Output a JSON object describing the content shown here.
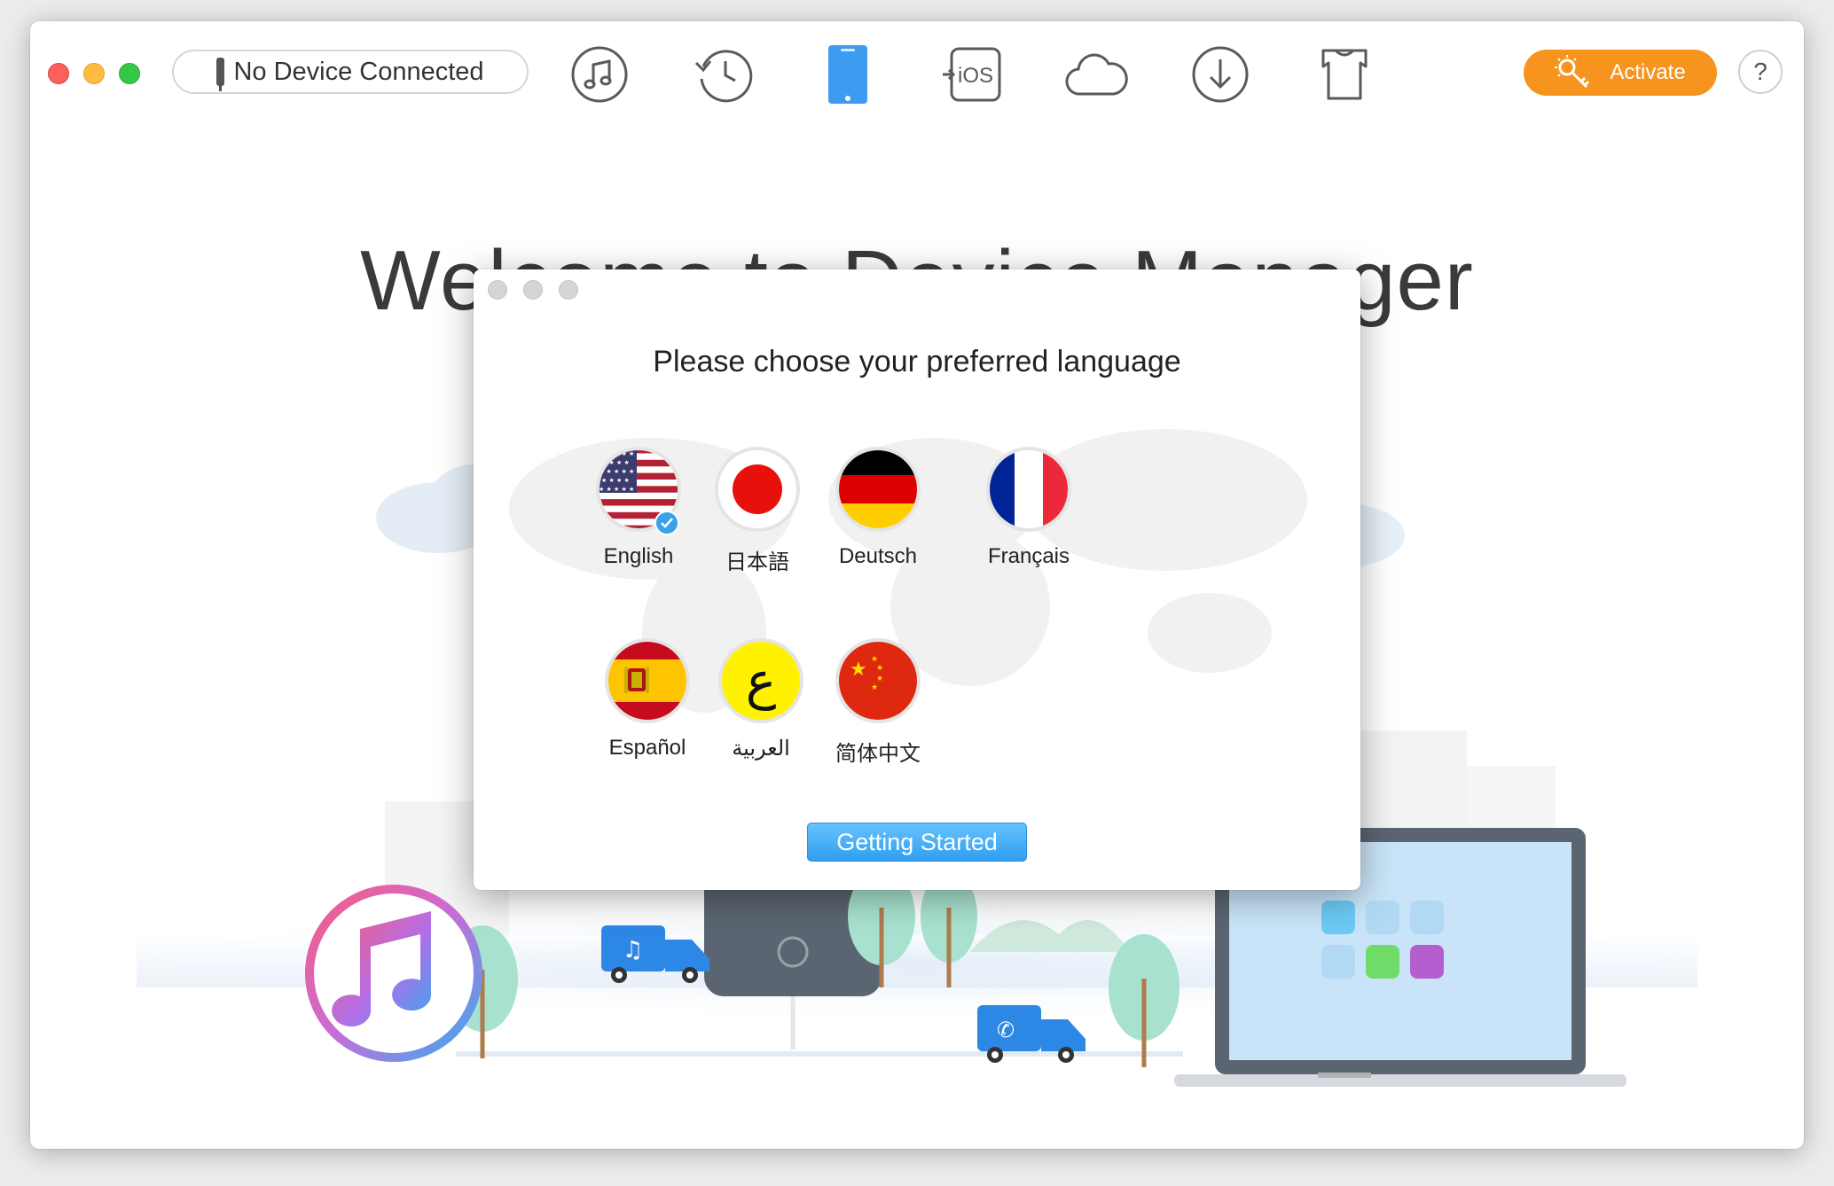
{
  "titlebar": {
    "device_status": "No Device Connected",
    "activate_label": "Activate",
    "help_label": "?",
    "toolbar_icons": [
      "music-icon",
      "history-icon",
      "device-icon",
      "ios-transfer-icon",
      "cloud-icon",
      "download-icon",
      "skin-icon"
    ],
    "ios_icon_text": "iOS"
  },
  "main": {
    "welcome_title": "Welcome to Device Manager"
  },
  "dialog": {
    "title": "Please choose your preferred language",
    "languages": [
      {
        "label": "English",
        "selected": true
      },
      {
        "label": "日本語",
        "selected": false
      },
      {
        "label": "Deutsch",
        "selected": false
      },
      {
        "label": "Français",
        "selected": false
      },
      {
        "label": "Español",
        "selected": false
      },
      {
        "label": "العربية",
        "selected": false
      },
      {
        "label": "简体中文",
        "selected": false
      }
    ],
    "arabic_glyph": "ع",
    "start_button": "Getting Started"
  },
  "colors": {
    "accent_blue": "#2f9ff0",
    "activate_orange": "#f7941d",
    "close_red": "#fc605c",
    "min_yellow": "#fdbc40",
    "max_green": "#34c84a"
  }
}
